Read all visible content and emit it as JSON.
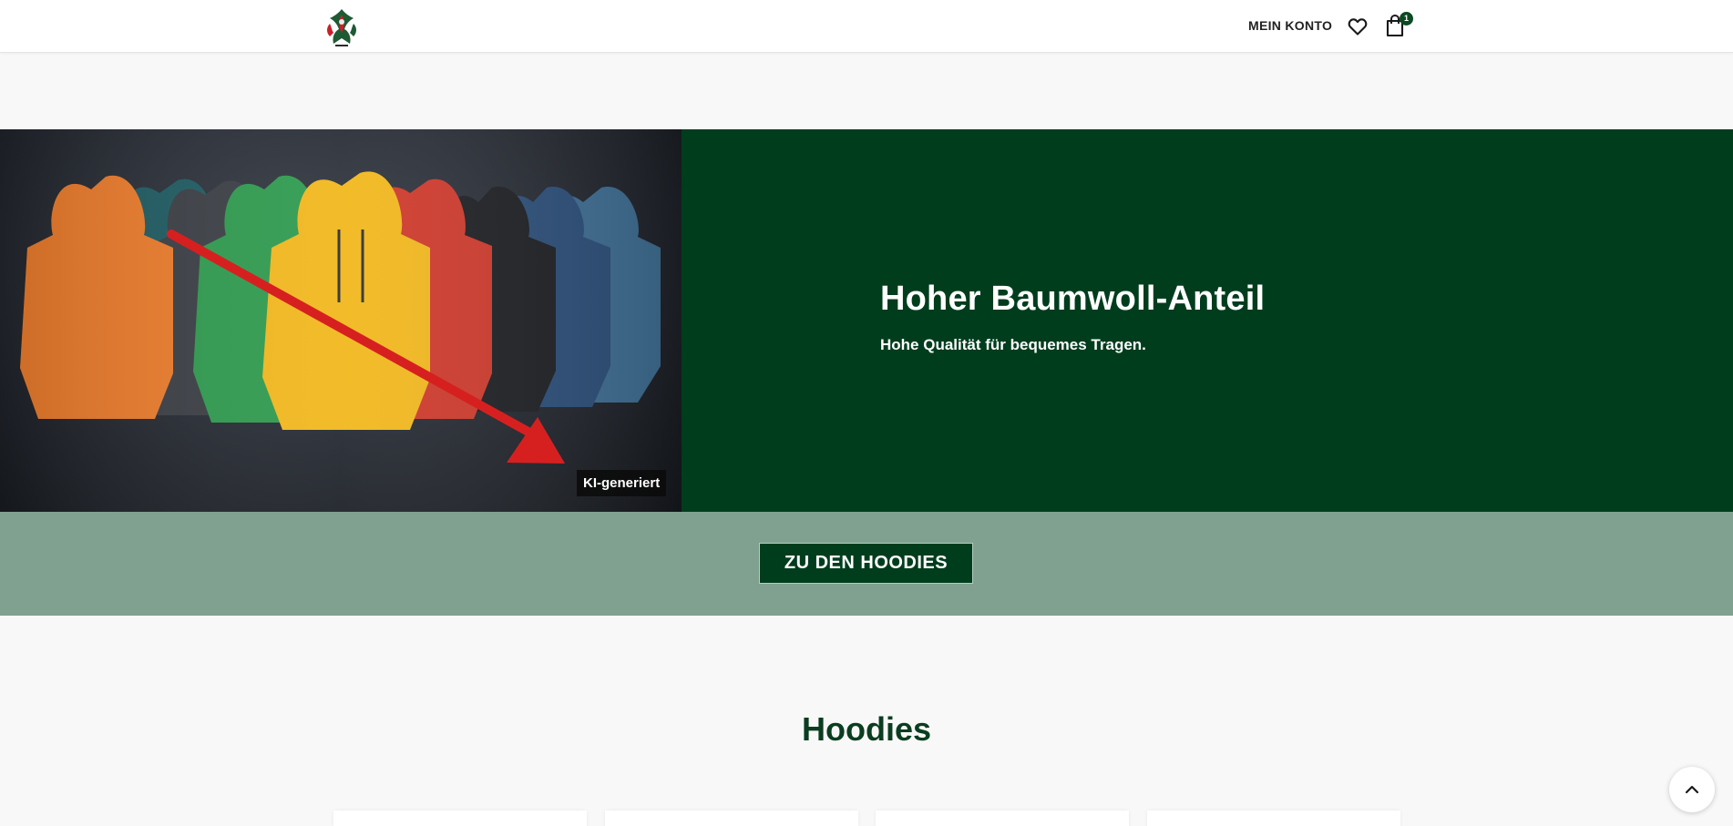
{
  "header": {
    "logo_alt": "Shop-Logo",
    "account_label": "MEIN KONTO",
    "wishlist_icon": "heart-icon",
    "cart_icon": "shopping-bag-icon",
    "cart_count": "1"
  },
  "hero": {
    "image_alt": "Farbige Hoodies nebeneinander",
    "ai_badge": "KI-generiert",
    "title": "Hoher Baumwoll-Anteil",
    "subtitle": "Hohe Qualität für bequemes Tragen.",
    "panel_color": "#003d1d"
  },
  "cta": {
    "button_label": "ZU DEN HOODIES",
    "band_color": "#80a190"
  },
  "section": {
    "title": "Hoodies"
  },
  "scroll_top": {
    "icon": "chevron-up-icon"
  },
  "colors": {
    "brand_green": "#003d1d",
    "accent_red": "#d62020"
  }
}
